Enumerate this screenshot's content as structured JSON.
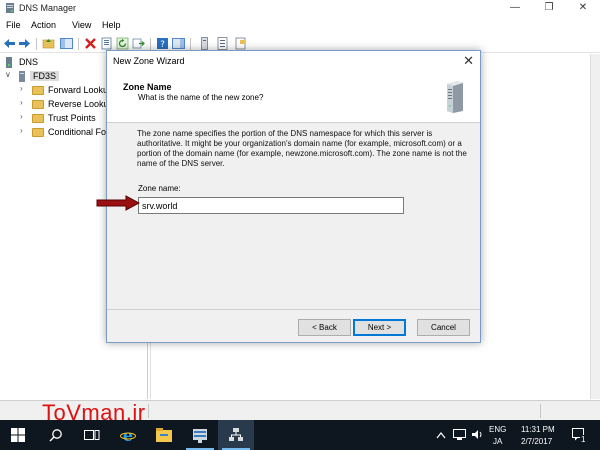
{
  "window": {
    "title": "DNS Manager"
  },
  "menu": [
    "File",
    "Action",
    "View",
    "Help"
  ],
  "tree": {
    "root": "DNS",
    "server": "FD3S",
    "items": [
      "Forward Looku",
      "Reverse Looku",
      "Trust Points",
      "Conditional Fo"
    ]
  },
  "wizard": {
    "title": "New Zone Wizard",
    "heading": "Zone Name",
    "subheading": "What is the name of the new zone?",
    "description": "The zone name specifies the portion of the DNS namespace for which this server is authoritative. It might be your organization's domain name (for example,  microsoft.com) or a portion of the domain name (for example, newzone.microsoft.com). The zone name is not the name of the DNS server.",
    "zone_label": "Zone name:",
    "zone_value": "srv.world",
    "back_label": "< Back",
    "next_label": "Next >",
    "cancel_label": "Cancel"
  },
  "watermark": "ToVman.ir",
  "taskbar": {
    "lang": "ENG",
    "ime": "JA",
    "time": "11:31 PM",
    "date": "2/7/2017",
    "notifications": "1"
  },
  "colors": {
    "accent": "#0078d7",
    "taskbar": "#0e1620",
    "folder": "#e8c15a",
    "arrow": "#8b0000"
  }
}
